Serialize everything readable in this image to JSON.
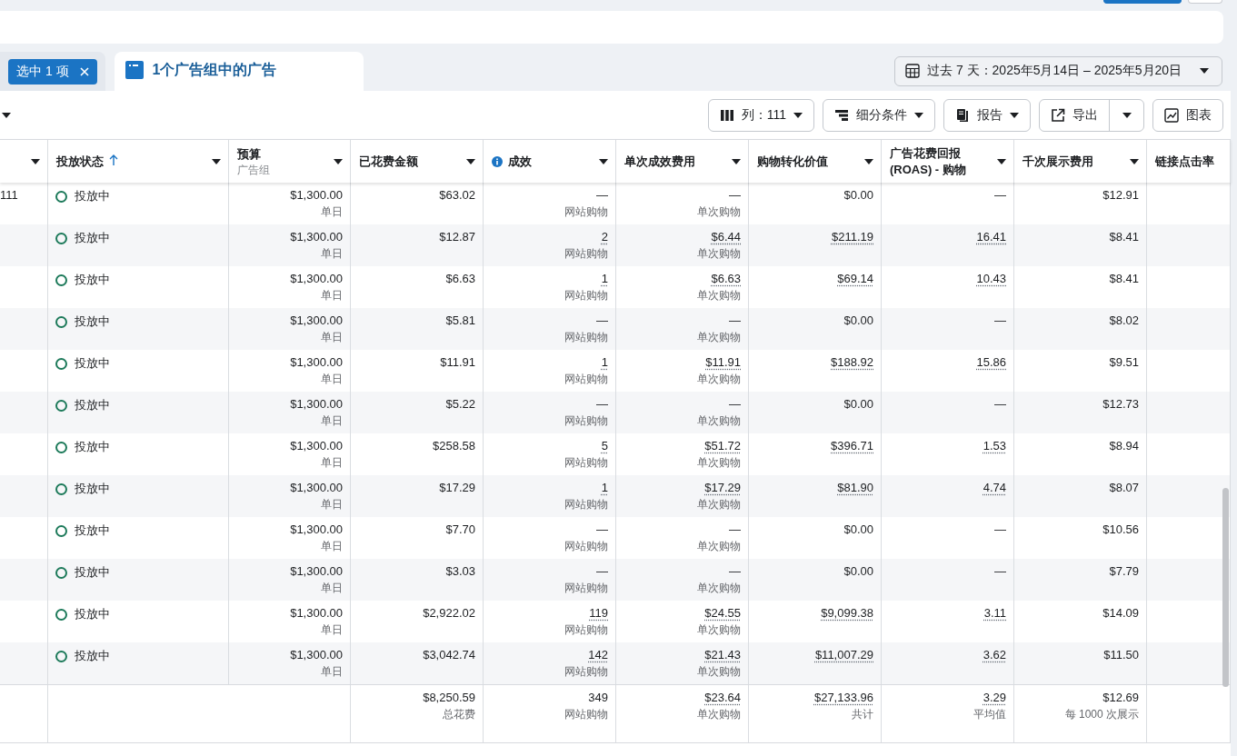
{
  "top_buttons": [
    {
      "kind": "primary"
    },
    {
      "kind": "secondary"
    }
  ],
  "tabs": [
    {
      "kind": "chip",
      "label": "选中 1 项",
      "selected": false
    },
    {
      "kind": "title",
      "label": "1个广告组中的广告",
      "selected": true
    }
  ],
  "date_range": {
    "label": "过去 7 天：2025年5月14日 – 2025年5月20日"
  },
  "toolbar": [
    {
      "kind": "menu",
      "label": "列：111"
    },
    {
      "kind": "menu",
      "label": "细分条件"
    },
    {
      "kind": "menu",
      "label": "报告"
    },
    {
      "kind": "split",
      "label": "导出"
    },
    {
      "kind": "plain",
      "label": "图表"
    }
  ],
  "columns": [
    {
      "caret": true,
      "sorted": false
    },
    {
      "label": "投放状态",
      "sorted": true,
      "caret": true
    },
    {
      "label": "预算",
      "sublabel": "广告组",
      "sorted": false,
      "caret": true
    },
    {
      "label": "已花费金额",
      "sorted": false,
      "caret": true
    },
    {
      "label": "成效",
      "info": true,
      "sorted": false,
      "caret": true
    },
    {
      "label": "单次成效费用",
      "sorted": false,
      "caret": true
    },
    {
      "label": "购物转化价值",
      "sorted": false,
      "caret": true
    },
    {
      "label": "广告花费回报 (ROAS) - 购物",
      "sorted": false,
      "caret": true
    },
    {
      "label": "千次展示费用",
      "sorted": false,
      "caret": true
    },
    {
      "label": "链接点击率",
      "sorted": false,
      "caret": false
    }
  ],
  "rows": [
    {
      "id": "111",
      "status": "投放中",
      "active": true,
      "budget": {
        "value": "$1,300.00",
        "note": "单日"
      },
      "spent": {
        "value": "$63.02"
      },
      "results": {
        "value": "—",
        "note": "网站购物",
        "underlined": false
      },
      "cost_per_result": {
        "value": "—",
        "note": "单次购物",
        "underlined": false
      },
      "purchase_value": {
        "value": "$0.00",
        "underlined": false
      },
      "roas": {
        "value": "—",
        "underlined": false
      },
      "cpm": {
        "value": "$12.91"
      }
    },
    {
      "status": "投放中",
      "active": true,
      "budget": {
        "value": "$1,300.00",
        "note": "单日"
      },
      "spent": {
        "value": "$12.87"
      },
      "results": {
        "value": "2",
        "note": "网站购物",
        "underlined": true
      },
      "cost_per_result": {
        "value": "$6.44",
        "note": "单次购物",
        "underlined": true
      },
      "purchase_value": {
        "value": "$211.19",
        "underlined": true
      },
      "roas": {
        "value": "16.41",
        "underlined": true
      },
      "cpm": {
        "value": "$8.41"
      }
    },
    {
      "status": "投放中",
      "active": true,
      "budget": {
        "value": "$1,300.00",
        "note": "单日"
      },
      "spent": {
        "value": "$6.63"
      },
      "results": {
        "value": "1",
        "note": "网站购物",
        "underlined": true
      },
      "cost_per_result": {
        "value": "$6.63",
        "note": "单次购物",
        "underlined": true
      },
      "purchase_value": {
        "value": "$69.14",
        "underlined": true
      },
      "roas": {
        "value": "10.43",
        "underlined": true
      },
      "cpm": {
        "value": "$8.41"
      }
    },
    {
      "status": "投放中",
      "active": true,
      "budget": {
        "value": "$1,300.00",
        "note": "单日"
      },
      "spent": {
        "value": "$5.81"
      },
      "results": {
        "value": "—",
        "note": "网站购物",
        "underlined": false
      },
      "cost_per_result": {
        "value": "—",
        "note": "单次购物",
        "underlined": false
      },
      "purchase_value": {
        "value": "$0.00",
        "underlined": false
      },
      "roas": {
        "value": "—",
        "underlined": false
      },
      "cpm": {
        "value": "$8.02"
      }
    },
    {
      "status": "投放中",
      "active": true,
      "budget": {
        "value": "$1,300.00",
        "note": "单日"
      },
      "spent": {
        "value": "$11.91"
      },
      "results": {
        "value": "1",
        "note": "网站购物",
        "underlined": true
      },
      "cost_per_result": {
        "value": "$11.91",
        "note": "单次购物",
        "underlined": true
      },
      "purchase_value": {
        "value": "$188.92",
        "underlined": true
      },
      "roas": {
        "value": "15.86",
        "underlined": true
      },
      "cpm": {
        "value": "$9.51"
      }
    },
    {
      "status": "投放中",
      "active": true,
      "budget": {
        "value": "$1,300.00",
        "note": "单日"
      },
      "spent": {
        "value": "$5.22"
      },
      "results": {
        "value": "—",
        "note": "网站购物",
        "underlined": false
      },
      "cost_per_result": {
        "value": "—",
        "note": "单次购物",
        "underlined": false
      },
      "purchase_value": {
        "value": "$0.00",
        "underlined": false
      },
      "roas": {
        "value": "—",
        "underlined": false
      },
      "cpm": {
        "value": "$12.73"
      }
    },
    {
      "status": "投放中",
      "active": true,
      "budget": {
        "value": "$1,300.00",
        "note": "单日"
      },
      "spent": {
        "value": "$258.58"
      },
      "results": {
        "value": "5",
        "note": "网站购物",
        "underlined": true
      },
      "cost_per_result": {
        "value": "$51.72",
        "note": "单次购物",
        "underlined": true
      },
      "purchase_value": {
        "value": "$396.71",
        "underlined": true
      },
      "roas": {
        "value": "1.53",
        "underlined": true
      },
      "cpm": {
        "value": "$8.94"
      }
    },
    {
      "status": "投放中",
      "active": true,
      "budget": {
        "value": "$1,300.00",
        "note": "单日"
      },
      "spent": {
        "value": "$17.29"
      },
      "results": {
        "value": "1",
        "note": "网站购物",
        "underlined": true
      },
      "cost_per_result": {
        "value": "$17.29",
        "note": "单次购物",
        "underlined": true
      },
      "purchase_value": {
        "value": "$81.90",
        "underlined": true
      },
      "roas": {
        "value": "4.74",
        "underlined": true
      },
      "cpm": {
        "value": "$8.07"
      }
    },
    {
      "status": "投放中",
      "active": true,
      "budget": {
        "value": "$1,300.00",
        "note": "单日"
      },
      "spent": {
        "value": "$7.70"
      },
      "results": {
        "value": "—",
        "note": "网站购物",
        "underlined": false
      },
      "cost_per_result": {
        "value": "—",
        "note": "单次购物",
        "underlined": false
      },
      "purchase_value": {
        "value": "$0.00",
        "underlined": false
      },
      "roas": {
        "value": "—",
        "underlined": false
      },
      "cpm": {
        "value": "$10.56"
      }
    },
    {
      "status": "投放中",
      "active": true,
      "budget": {
        "value": "$1,300.00",
        "note": "单日"
      },
      "spent": {
        "value": "$3.03"
      },
      "results": {
        "value": "—",
        "note": "网站购物",
        "underlined": false
      },
      "cost_per_result": {
        "value": "—",
        "note": "单次购物",
        "underlined": false
      },
      "purchase_value": {
        "value": "$0.00",
        "underlined": false
      },
      "roas": {
        "value": "—",
        "underlined": false
      },
      "cpm": {
        "value": "$7.79"
      }
    },
    {
      "status": "投放中",
      "active": true,
      "budget": {
        "value": "$1,300.00",
        "note": "单日"
      },
      "spent": {
        "value": "$2,922.02"
      },
      "results": {
        "value": "119",
        "note": "网站购物",
        "underlined": true
      },
      "cost_per_result": {
        "value": "$24.55",
        "note": "单次购物",
        "underlined": true
      },
      "purchase_value": {
        "value": "$9,099.38",
        "underlined": true
      },
      "roas": {
        "value": "3.11",
        "underlined": true
      },
      "cpm": {
        "value": "$14.09"
      }
    },
    {
      "status": "投放中",
      "active": true,
      "budget": {
        "value": "$1,300.00",
        "note": "单日"
      },
      "spent": {
        "value": "$3,042.74"
      },
      "results": {
        "value": "142",
        "note": "网站购物",
        "underlined": true
      },
      "cost_per_result": {
        "value": "$21.43",
        "note": "单次购物",
        "underlined": true
      },
      "purchase_value": {
        "value": "$11,007.29",
        "underlined": true
      },
      "roas": {
        "value": "3.62",
        "underlined": true
      },
      "cpm": {
        "value": "$11.50"
      }
    }
  ],
  "totals": {
    "spent": {
      "value": "$8,250.59",
      "note": "总花费"
    },
    "results": {
      "value": "349",
      "note": "网站购物",
      "underlined": false
    },
    "cost_per_result": {
      "value": "$23.64",
      "note": "单次购物",
      "underlined": true
    },
    "purchase_value": {
      "value": "$27,133.96",
      "note": "共计",
      "underlined": true
    },
    "roas": {
      "value": "3.29",
      "note": "平均值",
      "underlined": true
    },
    "cpm": {
      "value": "$12.69",
      "note": "每 1000 次展示"
    }
  }
}
